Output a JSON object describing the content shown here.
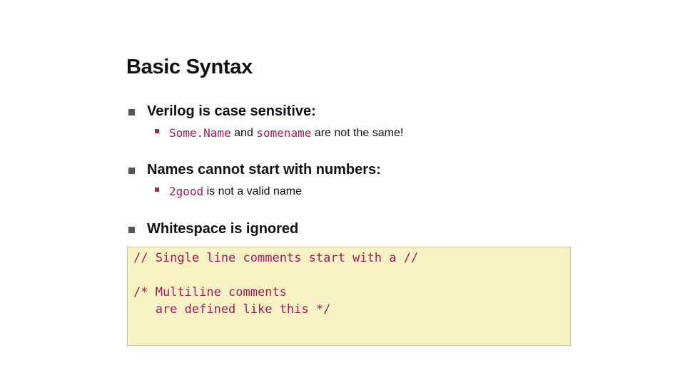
{
  "slide": {
    "title": "Basic Syntax",
    "bullets": [
      {
        "text": "Verilog is case sensitive:",
        "sub": {
          "code1": "Some.Name",
          "mid": "and",
          "code2": "somename",
          "rest": "are not the same!"
        }
      },
      {
        "text": "Names cannot start with numbers:",
        "sub": {
          "code1": "2good",
          "rest": "is not a valid name"
        }
      },
      {
        "text": "Whitespace is ignored"
      }
    ],
    "code_box": {
      "lines": [
        "// Single line comments start with a //",
        "",
        "/* Multiline comments",
        "   are defined like this */"
      ]
    }
  },
  "colors": {
    "code_text": "#a3195b",
    "code_background": "#f8f3c5",
    "sub_bullet": "#9c2a5b"
  }
}
